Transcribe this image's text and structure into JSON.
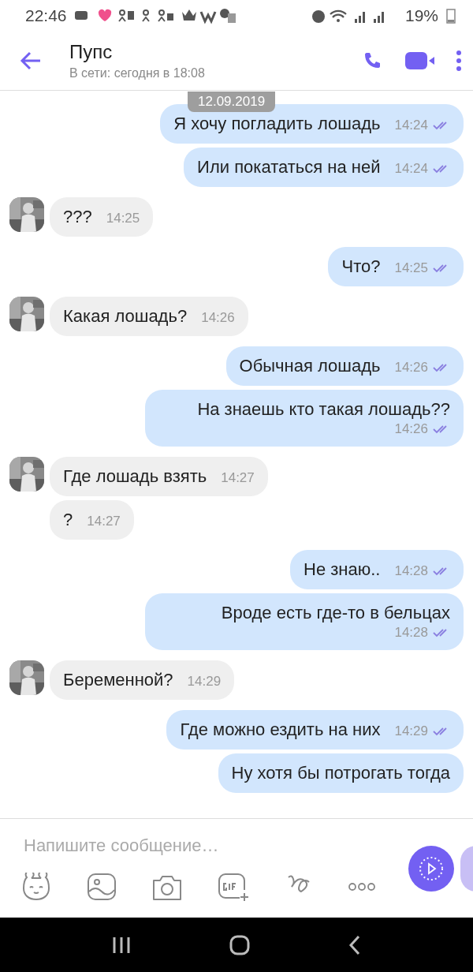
{
  "status_bar": {
    "time": "22:46",
    "battery": "19%"
  },
  "header": {
    "title": "Пупс",
    "subtitle": "В сети: сегодня в 18:08"
  },
  "date_chip": "12.09.2019",
  "messages": [
    {
      "kind": "out",
      "text": "Я хочу погладить лошадь",
      "time": "14:24"
    },
    {
      "kind": "out",
      "text": "Или покататься на ней",
      "time": "14:24"
    },
    {
      "kind": "in",
      "text": "???",
      "time": "14:25"
    },
    {
      "kind": "out",
      "text": "Что?",
      "time": "14:25"
    },
    {
      "kind": "in",
      "text": "Какая лошадь?",
      "time": "14:26"
    },
    {
      "kind": "out",
      "text": "Обычная лошадь",
      "time": "14:26"
    },
    {
      "kind": "out",
      "text": "На знаешь кто такая лошадь??",
      "time": "14:26"
    },
    {
      "kind": "in",
      "text": "Где лошадь взять",
      "time": "14:27"
    },
    {
      "kind": "in",
      "text": "?",
      "time": "14:27"
    },
    {
      "kind": "out",
      "text": "Не знаю..",
      "time": "14:28"
    },
    {
      "kind": "out",
      "text": "Вроде есть где-то в бельцах",
      "time": "14:28"
    },
    {
      "kind": "in",
      "text": "Беременной?",
      "time": "14:29"
    },
    {
      "kind": "out",
      "text": "Где можно ездить на них",
      "time": "14:29"
    },
    {
      "kind": "out",
      "text": "Ну хотя бы потрогать тогда"
    }
  ],
  "composer": {
    "placeholder": "Напишите сообщение…"
  }
}
